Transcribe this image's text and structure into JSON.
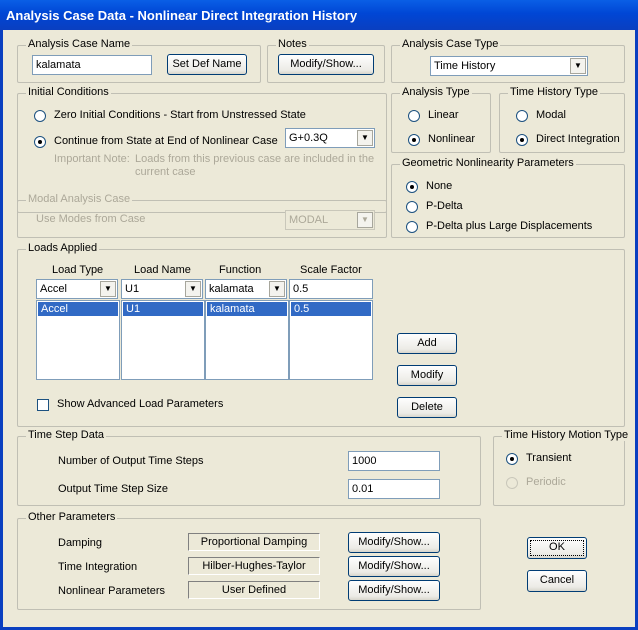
{
  "window": {
    "title": "Analysis Case Data - Nonlinear Direct Integration History"
  },
  "analysis_case_name": {
    "legend": "Analysis Case Name",
    "value": "kalamata",
    "set_def_name": "Set Def Name"
  },
  "notes": {
    "legend": "Notes",
    "button": "Modify/Show..."
  },
  "analysis_case_type": {
    "legend": "Analysis Case Type",
    "value": "Time History"
  },
  "initial_conditions": {
    "legend": "Initial Conditions",
    "zero": "Zero Initial Conditions - Start from Unstressed State",
    "continue": "Continue from State at End of Nonlinear Case",
    "case_value": "G+0.3Q",
    "note_label": "Important Note:",
    "note_text1": "Loads from this previous case are included in the",
    "note_text2": "current case"
  },
  "analysis_type": {
    "legend": "Analysis Type",
    "linear": "Linear",
    "nonlinear": "Nonlinear"
  },
  "time_history_type": {
    "legend": "Time History Type",
    "modal": "Modal",
    "direct": "Direct Integration"
  },
  "geometric": {
    "legend": "Geometric Nonlinearity Parameters",
    "none": "None",
    "pdelta": "P-Delta",
    "pdelta_large": "P-Delta plus Large Displacements"
  },
  "modal_case": {
    "legend": "Modal Analysis Case",
    "label": "Use Modes from Case",
    "value": "MODAL"
  },
  "loads": {
    "legend": "Loads Applied",
    "headers": [
      "Load Type",
      "Load Name",
      "Function",
      "Scale Factor"
    ],
    "edit_row": [
      "Accel",
      "U1",
      "kalamata",
      "0.5"
    ],
    "rows": [
      [
        "Accel",
        "U1",
        "kalamata",
        "0.5"
      ]
    ],
    "add": "Add",
    "modify": "Modify",
    "delete": "Delete",
    "advanced": "Show Advanced Load Parameters"
  },
  "time_step": {
    "legend": "Time Step Data",
    "num_label": "Number of Output Time Steps",
    "num_value": "1000",
    "size_label": "Output Time Step Size",
    "size_value": "0.01"
  },
  "motion_type": {
    "legend": "Time History Motion Type",
    "transient": "Transient",
    "periodic": "Periodic"
  },
  "other": {
    "legend": "Other Parameters",
    "damping_label": "Damping",
    "damping_value": "Proportional Damping",
    "integration_label": "Time Integration",
    "integration_value": "Hilber-Hughes-Taylor",
    "nonlinear_label": "Nonlinear Parameters",
    "nonlinear_value": "User Defined",
    "modify_show": "Modify/Show..."
  },
  "buttons": {
    "ok": "OK",
    "cancel": "Cancel"
  }
}
